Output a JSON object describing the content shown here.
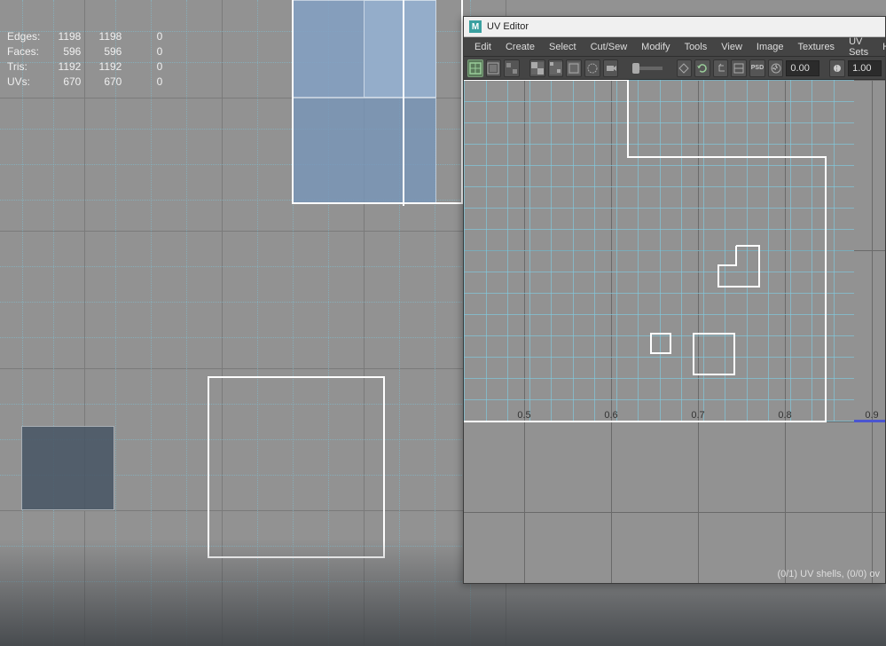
{
  "hud": {
    "rows": [
      {
        "label": "Edges:",
        "a": "1198",
        "b": "1198",
        "c": "0"
      },
      {
        "label": "Faces:",
        "a": "596",
        "b": "596",
        "c": "0"
      },
      {
        "label": "Tris:",
        "a": "1192",
        "b": "1192",
        "c": "0"
      },
      {
        "label": "UVs:",
        "a": "670",
        "b": "670",
        "c": "0"
      }
    ]
  },
  "uvEditor": {
    "title": "UV Editor",
    "logo": "M",
    "menus": [
      "Edit",
      "Create",
      "Select",
      "Cut/Sew",
      "Modify",
      "Tools",
      "View",
      "Image",
      "Textures",
      "UV Sets",
      "Help"
    ],
    "field_dim": "0.00",
    "field_exp": "1.00",
    "axis_ticks": [
      "0.5",
      "0.6",
      "0.7",
      "0.8",
      "0.9"
    ],
    "status": "(0/1) UV shells, (0/0) ov"
  }
}
